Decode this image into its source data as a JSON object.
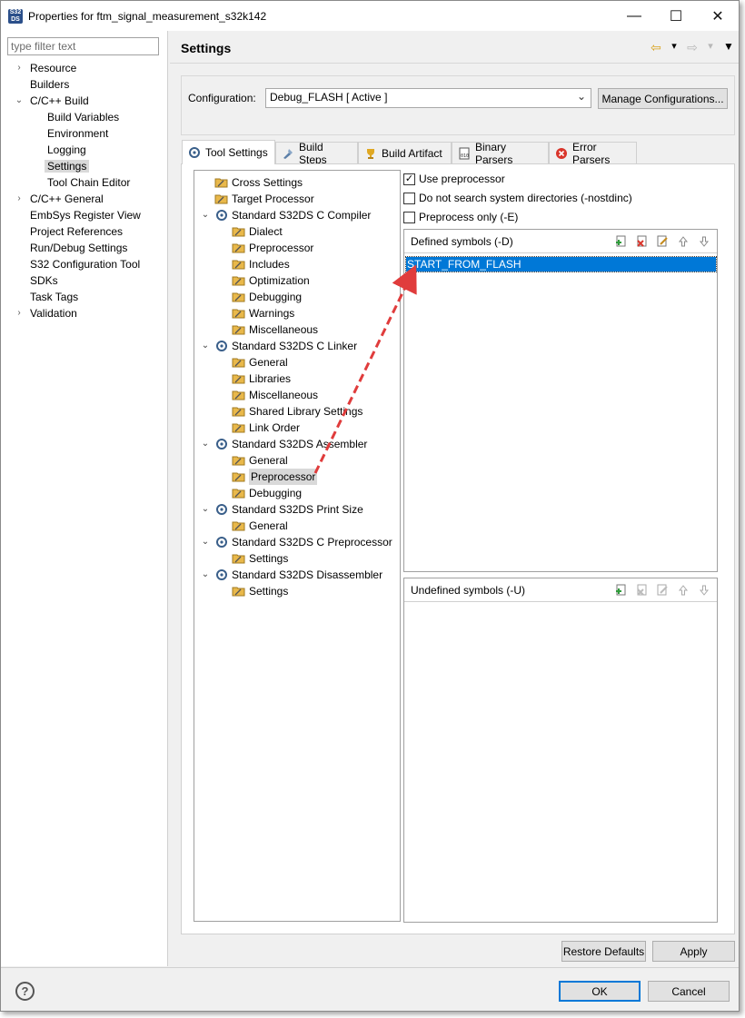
{
  "window": {
    "title": "Properties for ftm_signal_measurement_s32k142",
    "app_icon_text": "S32 DS",
    "minimize_glyph": "—",
    "maximize_glyph": "☐",
    "close_glyph": "✕"
  },
  "left_nav": {
    "filter_placeholder": "type filter text",
    "items": [
      {
        "label": "Resource",
        "twisty": ">"
      },
      {
        "label": "Builders",
        "twisty": ""
      },
      {
        "label": "C/C++ Build",
        "twisty": "v"
      },
      {
        "label": "Build Variables",
        "twisty": ""
      },
      {
        "label": "Environment",
        "twisty": ""
      },
      {
        "label": "Logging",
        "twisty": ""
      },
      {
        "label": "Settings",
        "twisty": ""
      },
      {
        "label": "Tool Chain Editor",
        "twisty": ""
      },
      {
        "label": "C/C++ General",
        "twisty": ">"
      },
      {
        "label": "EmbSys Register View",
        "twisty": ""
      },
      {
        "label": "Project References",
        "twisty": ""
      },
      {
        "label": "Run/Debug Settings",
        "twisty": ""
      },
      {
        "label": "S32 Configuration Tool",
        "twisty": ""
      },
      {
        "label": "SDKs",
        "twisty": ""
      },
      {
        "label": "Task Tags",
        "twisty": ""
      },
      {
        "label": "Validation",
        "twisty": ">"
      }
    ],
    "selected": "Settings"
  },
  "header": {
    "title": "Settings",
    "back_glyph": "⇦",
    "forward_glyph": "⇨",
    "dropdown_glyph": "▾"
  },
  "configuration": {
    "label": "Configuration:",
    "value": "Debug_FLASH  [ Active ]",
    "manage_button": "Manage Configurations..."
  },
  "tabs": [
    {
      "label": "Tool Settings",
      "icon": "tool-settings-icon",
      "active": true
    },
    {
      "label": "Build Steps",
      "icon": "build-steps-icon",
      "active": false
    },
    {
      "label": "Build Artifact",
      "icon": "trophy-icon",
      "active": false
    },
    {
      "label": "Binary Parsers",
      "icon": "binary-icon",
      "active": false
    },
    {
      "label": "Error Parsers",
      "icon": "error-icon",
      "active": false
    }
  ],
  "tool_tree": [
    {
      "label": "Cross Settings",
      "level": 0,
      "kind": "option",
      "chevron": ""
    },
    {
      "label": "Target Processor",
      "level": 0,
      "kind": "option",
      "chevron": ""
    },
    {
      "label": "Standard S32DS C Compiler",
      "level": 0,
      "kind": "tool",
      "chevron": "v"
    },
    {
      "label": "Dialect",
      "level": 1,
      "kind": "option",
      "chevron": ""
    },
    {
      "label": "Preprocessor",
      "level": 1,
      "kind": "option",
      "chevron": ""
    },
    {
      "label": "Includes",
      "level": 1,
      "kind": "option",
      "chevron": ""
    },
    {
      "label": "Optimization",
      "level": 1,
      "kind": "option",
      "chevron": ""
    },
    {
      "label": "Debugging",
      "level": 1,
      "kind": "option",
      "chevron": ""
    },
    {
      "label": "Warnings",
      "level": 1,
      "kind": "option",
      "chevron": ""
    },
    {
      "label": "Miscellaneous",
      "level": 1,
      "kind": "option",
      "chevron": ""
    },
    {
      "label": "Standard S32DS C Linker",
      "level": 0,
      "kind": "tool",
      "chevron": "v"
    },
    {
      "label": "General",
      "level": 1,
      "kind": "option",
      "chevron": ""
    },
    {
      "label": "Libraries",
      "level": 1,
      "kind": "option",
      "chevron": ""
    },
    {
      "label": "Miscellaneous",
      "level": 1,
      "kind": "option",
      "chevron": ""
    },
    {
      "label": "Shared Library Settings",
      "level": 1,
      "kind": "option",
      "chevron": ""
    },
    {
      "label": "Link Order",
      "level": 1,
      "kind": "option",
      "chevron": ""
    },
    {
      "label": "Standard S32DS Assembler",
      "level": 0,
      "kind": "tool",
      "chevron": "v"
    },
    {
      "label": "General",
      "level": 1,
      "kind": "option",
      "chevron": ""
    },
    {
      "label": "Preprocessor",
      "level": 1,
      "kind": "option",
      "chevron": "",
      "selected": true
    },
    {
      "label": "Debugging",
      "level": 1,
      "kind": "option",
      "chevron": ""
    },
    {
      "label": "Standard S32DS Print Size",
      "level": 0,
      "kind": "tool",
      "chevron": "v"
    },
    {
      "label": "General",
      "level": 1,
      "kind": "option",
      "chevron": ""
    },
    {
      "label": "Standard S32DS C Preprocessor",
      "level": 0,
      "kind": "tool",
      "chevron": "v"
    },
    {
      "label": "Settings",
      "level": 1,
      "kind": "option",
      "chevron": ""
    },
    {
      "label": "Standard S32DS Disassembler",
      "level": 0,
      "kind": "tool",
      "chevron": "v"
    },
    {
      "label": "Settings",
      "level": 1,
      "kind": "option",
      "chevron": ""
    }
  ],
  "options": {
    "use_preprocessor": {
      "label": "Use preprocessor",
      "checked": true
    },
    "no_std_dirs": {
      "label": "Do not search system directories (-nostdinc)",
      "checked": false
    },
    "preprocess_only": {
      "label": "Preprocess only (-E)",
      "checked": false
    }
  },
  "defined_symbols": {
    "title": "Defined symbols (-D)",
    "items": [
      "START_FROM_FLASH"
    ]
  },
  "undefined_symbols": {
    "title": "Undefined symbols (-U)",
    "items": []
  },
  "list_tool_icons": [
    "add-icon",
    "delete-icon",
    "edit-icon",
    "move-up-icon",
    "move-down-icon"
  ],
  "buttons": {
    "restore_defaults": "Restore Defaults",
    "apply": "Apply",
    "ok": "OK",
    "cancel": "Cancel",
    "help": "?"
  },
  "colors": {
    "selection_blue": "#0078d7",
    "annotation_arrow": "#e03c3c",
    "folder_yellow": "#e9b84a"
  }
}
